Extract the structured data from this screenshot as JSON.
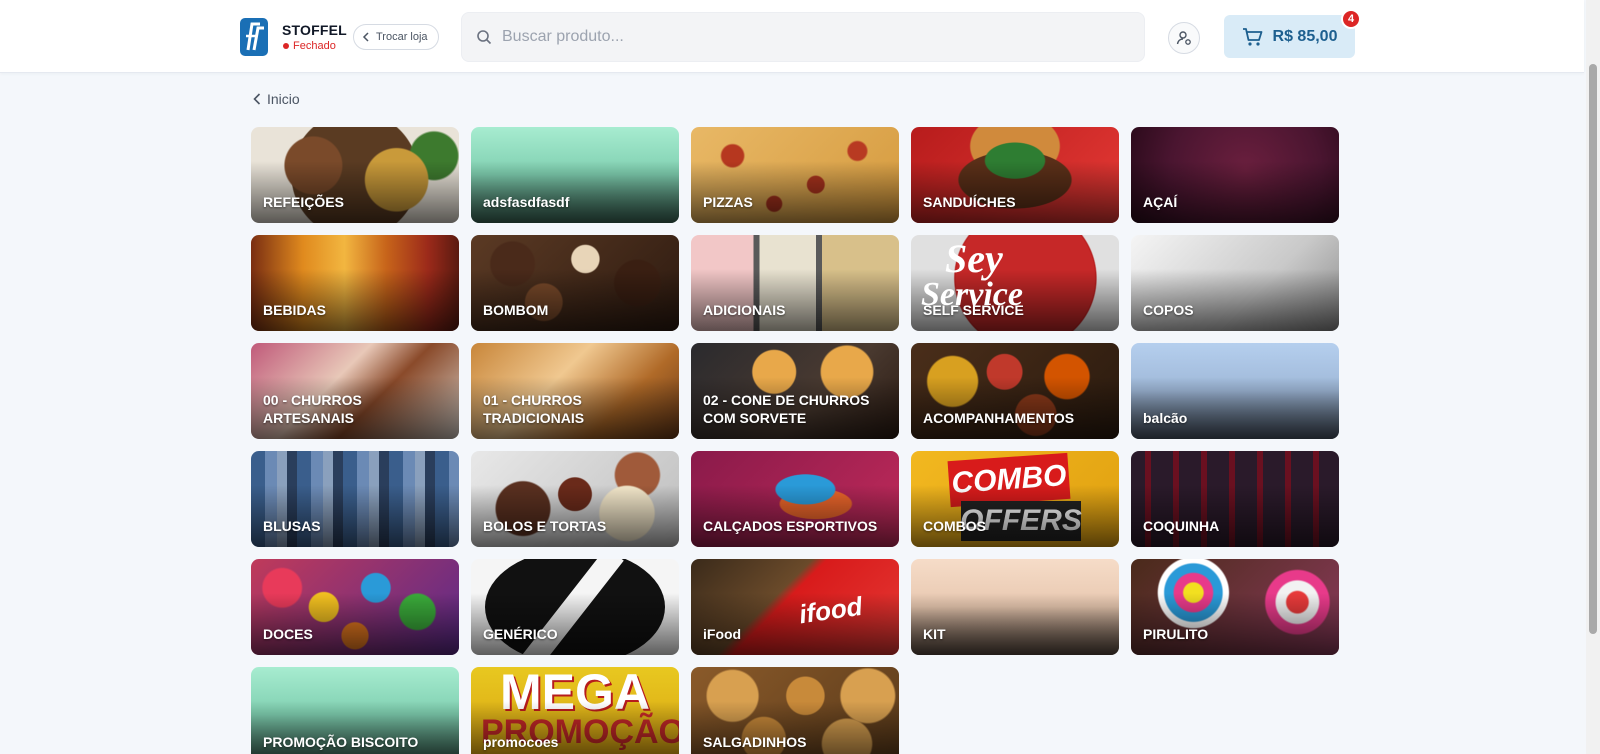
{
  "header": {
    "store_name": "STOFFEL",
    "store_status": "Fechado",
    "switch_store_label": "Trocar loja",
    "search_placeholder": "Buscar produto...",
    "cart_total": "R$ 85,00",
    "cart_count": "4"
  },
  "breadcrumb": {
    "back_label": "Inicio"
  },
  "categories": [
    {
      "label": "REFEIÇÕES"
    },
    {
      "label": "adsfasdfasdf"
    },
    {
      "label": "PIZZAS"
    },
    {
      "label": "SANDUÍCHES"
    },
    {
      "label": "AÇAÍ"
    },
    {
      "label": "BEBIDAS"
    },
    {
      "label": "BOMBOM"
    },
    {
      "label": "ADICIONAIS"
    },
    {
      "label": "SELF SERVICE"
    },
    {
      "label": "COPOS"
    },
    {
      "label": "00 - CHURROS ARTESANAIS"
    },
    {
      "label": "01 - CHURROS TRADICIONAIS"
    },
    {
      "label": "02 - CONE DE CHURROS COM SORVETE"
    },
    {
      "label": "ACOMPANHAMENTOS"
    },
    {
      "label": "balcão"
    },
    {
      "label": "BLUSAS"
    },
    {
      "label": "BOLOS E TORTAS"
    },
    {
      "label": "CALÇADOS ESPORTIVOS"
    },
    {
      "label": "COMBOS"
    },
    {
      "label": "COQUINHA"
    },
    {
      "label": "DOCES"
    },
    {
      "label": "GENÉRICO"
    },
    {
      "label": "iFood"
    },
    {
      "label": "KIT"
    },
    {
      "label": "PIRULITO"
    },
    {
      "label": "PROMOÇÃO BISCOITO"
    },
    {
      "label": "promocoes"
    },
    {
      "label": "SALGADINHOS"
    }
  ],
  "image_text": {
    "self_service_line1": "Sey",
    "self_service_line2": "Service",
    "combo_line1": "COMBO",
    "combo_line2": "OFFERS",
    "ifood_logo": "ifood",
    "mega_line1": "MEGA",
    "mega_line2": "PROMOÇÃO"
  },
  "colors": {
    "accent": "#1d5f8f",
    "cart_background": "#d9ebf7",
    "status_closed": "#dc2626",
    "badge": "#dc2626",
    "page_background": "#f4f7fb"
  },
  "icons": {
    "logo": "stoffel-logo",
    "back": "chevron-left-icon",
    "search": "search-icon",
    "user": "user-settings-icon",
    "cart": "shopping-cart-icon"
  }
}
